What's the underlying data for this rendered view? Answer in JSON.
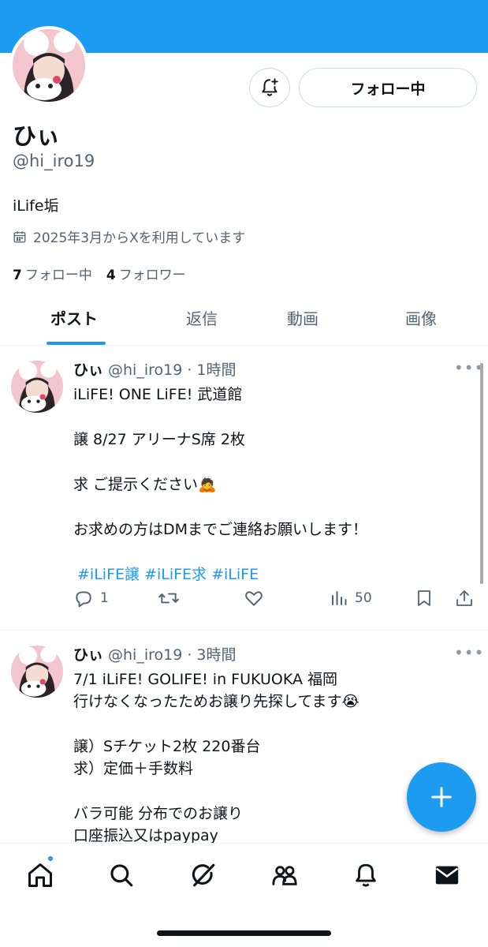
{
  "profile": {
    "display_name": "ひぃ",
    "handle": "@hi_iro19",
    "bio": "iLife垢",
    "joined": "2025年3月からXを利用しています",
    "following_count": "7",
    "following_label": "フォロー中",
    "followers_count": "4",
    "followers_label": "フォロワー",
    "follow_button_label": "フォロー中"
  },
  "tabs": [
    {
      "label": "ポスト"
    },
    {
      "label": "返信"
    },
    {
      "label": "動画"
    },
    {
      "label": "画像"
    }
  ],
  "posts": [
    {
      "name": "ひぃ",
      "handle": "@hi_iro19",
      "time": "· 1時間",
      "lines": [
        "iLiFE! ONE LiFE! 武道館",
        "譲 8/27 アリーナS席 2枚",
        "求 ご提示ください🙇",
        "お求めの方はDMまでご連絡お願いします！"
      ],
      "hashtags": "#iLiFE譲 #iLiFE求  #iLiFE",
      "replies": "1",
      "views": "50"
    },
    {
      "name": "ひぃ",
      "handle": "@hi_iro19",
      "time": "· 3時間",
      "lines": [
        "7/1 iLiFE! GOLIFE! in FUKUOKA 福岡",
        "行けなくなったためお譲り先探してます😭",
        "譲）Sチケット2枚  220番台",
        "求）定価＋手数料",
        "バラ可能  分布でのお譲り",
        "口座振込又はpaypay"
      ]
    }
  ],
  "colors": {
    "accent": "#1d9bf0",
    "text_primary": "#0f1419",
    "text_secondary": "#536471",
    "border": "#cfd9de"
  },
  "icons": {
    "notif_button": "bell-plus-icon",
    "joined": "calendar-icon",
    "post_more": "more-horizontal-icon",
    "reply": "reply-icon",
    "repost": "repost-icon",
    "like": "heart-icon",
    "views": "views-icon",
    "bookmark": "bookmark-icon",
    "share": "share-icon",
    "fab": "plus-icon",
    "nav": [
      "home-icon",
      "search-icon",
      "grok-icon",
      "communities-icon",
      "bell-icon",
      "mail-icon"
    ]
  }
}
